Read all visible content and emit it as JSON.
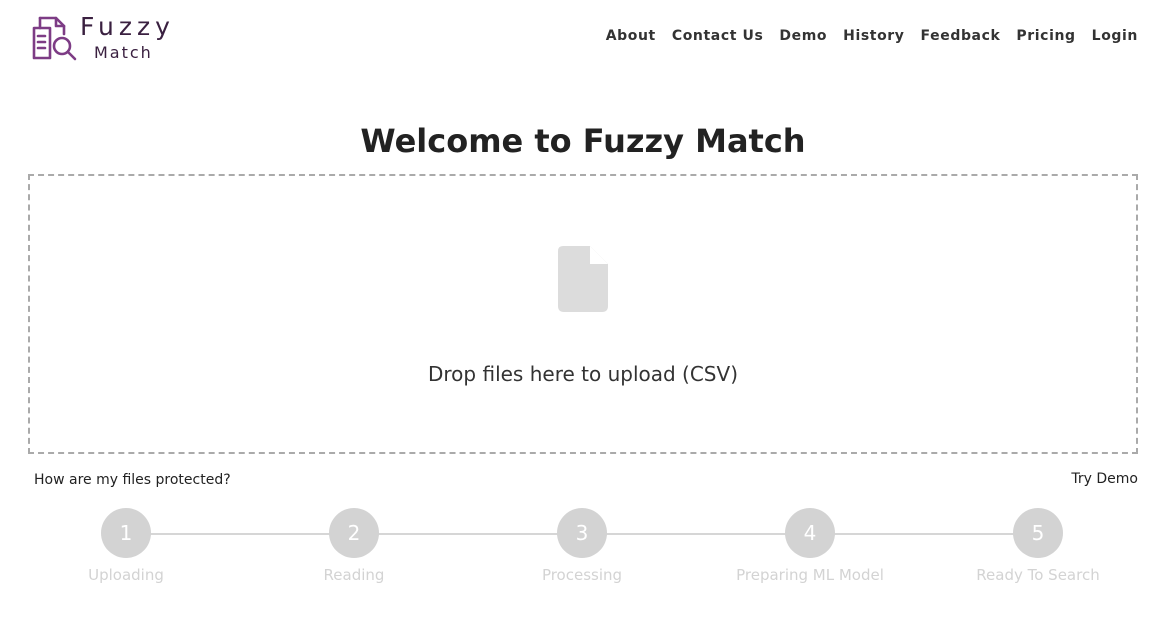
{
  "brand": {
    "name_line1": "Fuzzy",
    "name_line2": "Match",
    "logo_color": "#7d3c85",
    "logo_icon": "document-search-icon"
  },
  "nav": {
    "items": [
      {
        "label": "About"
      },
      {
        "label": "Contact Us"
      },
      {
        "label": "Demo"
      },
      {
        "label": "History"
      },
      {
        "label": "Feedback"
      },
      {
        "label": "Pricing"
      },
      {
        "label": "Login"
      }
    ]
  },
  "main": {
    "title": "Welcome to Fuzzy Match",
    "dropzone": {
      "icon": "file-icon",
      "text": "Drop files here to upload (CSV)"
    },
    "protection_link": "How are my files protected?",
    "try_demo_link": "Try Demo"
  },
  "steps": [
    {
      "number": "1",
      "label": "Uploading"
    },
    {
      "number": "2",
      "label": "Reading"
    },
    {
      "number": "3",
      "label": "Processing"
    },
    {
      "number": "4",
      "label": "Preparing ML Model"
    },
    {
      "number": "5",
      "label": "Ready To Search"
    }
  ],
  "colors": {
    "step_inactive": "#d3d3d3",
    "dropzone_border": "#aaaaaa"
  }
}
